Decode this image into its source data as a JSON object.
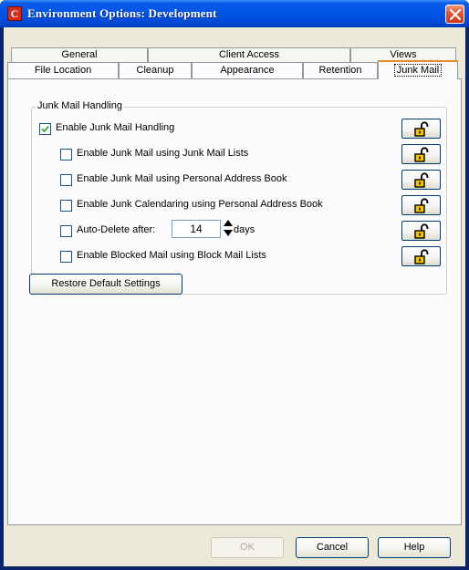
{
  "window": {
    "title": "Environment Options:  Development",
    "app_icon_letter": "C"
  },
  "tabs": {
    "back_row": [
      {
        "label": "General"
      },
      {
        "label": "Client Access"
      },
      {
        "label": "Views"
      }
    ],
    "front_row": [
      {
        "label": "File Location"
      },
      {
        "label": "Cleanup"
      },
      {
        "label": "Appearance"
      },
      {
        "label": "Retention"
      },
      {
        "label": "Junk Mail",
        "selected": true
      }
    ]
  },
  "junk_mail": {
    "group_label": "Junk Mail Handling",
    "options": [
      {
        "label": "Enable Junk Mail Handling",
        "checked": true,
        "lock_icon": "unlocked-padlock-icon"
      },
      {
        "label": "Enable Junk Mail using Junk Mail Lists",
        "checked": false,
        "lock_icon": "unlocked-padlock-icon"
      },
      {
        "label": "Enable Junk Mail using Personal Address Book",
        "checked": false,
        "lock_icon": "unlocked-padlock-icon"
      },
      {
        "label": "Enable Junk Calendaring using Personal Address Book",
        "checked": false,
        "lock_icon": "unlocked-padlock-icon"
      },
      {
        "label": "Auto-Delete after:",
        "checked": false,
        "lock_icon": "unlocked-padlock-icon"
      },
      {
        "label": "Enable Blocked Mail using Block Mail Lists",
        "checked": false,
        "lock_icon": "unlocked-padlock-icon"
      }
    ],
    "auto_delete_value": "14",
    "auto_delete_unit": "days",
    "restore_button": "Restore Default Settings"
  },
  "footer": {
    "ok": "OK",
    "ok_enabled": false,
    "cancel": "Cancel",
    "help": "Help"
  },
  "colors": {
    "titlebar": "#0055e5",
    "dialog_bg": "#ece9d8",
    "panel_bg": "#fcfcfe",
    "active_tab_accent": "#e68b2c",
    "lock_yellow": "#f4c400"
  }
}
